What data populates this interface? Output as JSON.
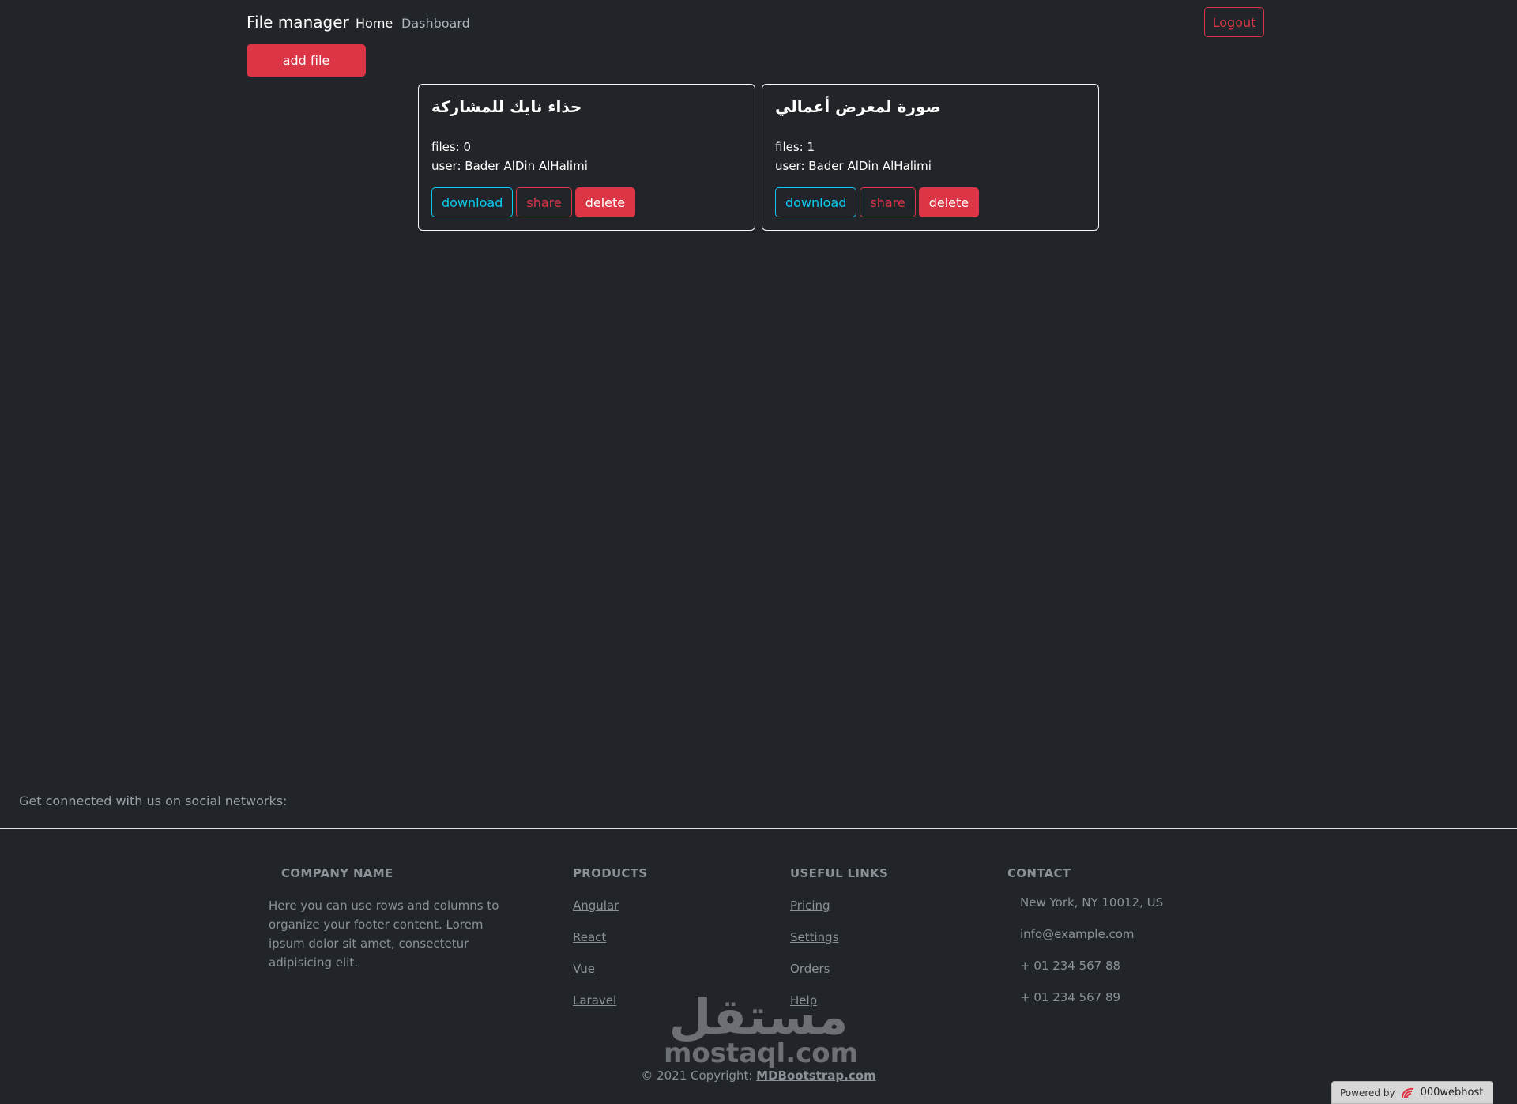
{
  "navbar": {
    "brand": "File manager",
    "links": [
      "Home",
      "Dashboard"
    ],
    "logout_label": "Logout"
  },
  "toolbar": {
    "add_file_label": "add file"
  },
  "cards": [
    {
      "title": "حذاء نايك للمشاركة",
      "files": "files: 0",
      "user": "user: Bader AlDin AlHalimi",
      "download_label": "download",
      "share_label": "share",
      "delete_label": "delete"
    },
    {
      "title": "صورة لمعرض أعمالي",
      "files": "files: 1",
      "user": "user: Bader AlDin AlHalimi",
      "download_label": "download",
      "share_label": "share",
      "delete_label": "delete"
    }
  ],
  "footer": {
    "social_text": "Get connected with us on social networks:",
    "company": {
      "heading": "COMPANY NAME",
      "text": "Here you can use rows and columns to organize your footer content. Lorem ipsum dolor sit amet, consectetur adipisicing elit."
    },
    "products": {
      "heading": "PRODUCTS",
      "items": [
        "Angular",
        "React",
        "Vue",
        "Laravel"
      ]
    },
    "useful_links": {
      "heading": "USEFUL LINKS",
      "items": [
        "Pricing",
        "Settings",
        "Orders",
        "Help"
      ]
    },
    "contact": {
      "heading": "CONTACT",
      "items": [
        "New York, NY 10012, US",
        "info@example.com",
        "+ 01 234 567 88",
        "+ 01 234 567 89"
      ]
    },
    "copyright_prefix": "© 2021 Copyright:",
    "copyright_link": "MDBootstrap.com"
  },
  "watermark": {
    "arabic": "مستقل",
    "latin": "mostaql.com"
  },
  "powered_by": {
    "label": "Powered by",
    "host": "000webhost"
  },
  "colors": {
    "background": "#212529",
    "danger": "#dc3545",
    "info": "#0dcaf0",
    "muted_text": "#8b9197"
  }
}
